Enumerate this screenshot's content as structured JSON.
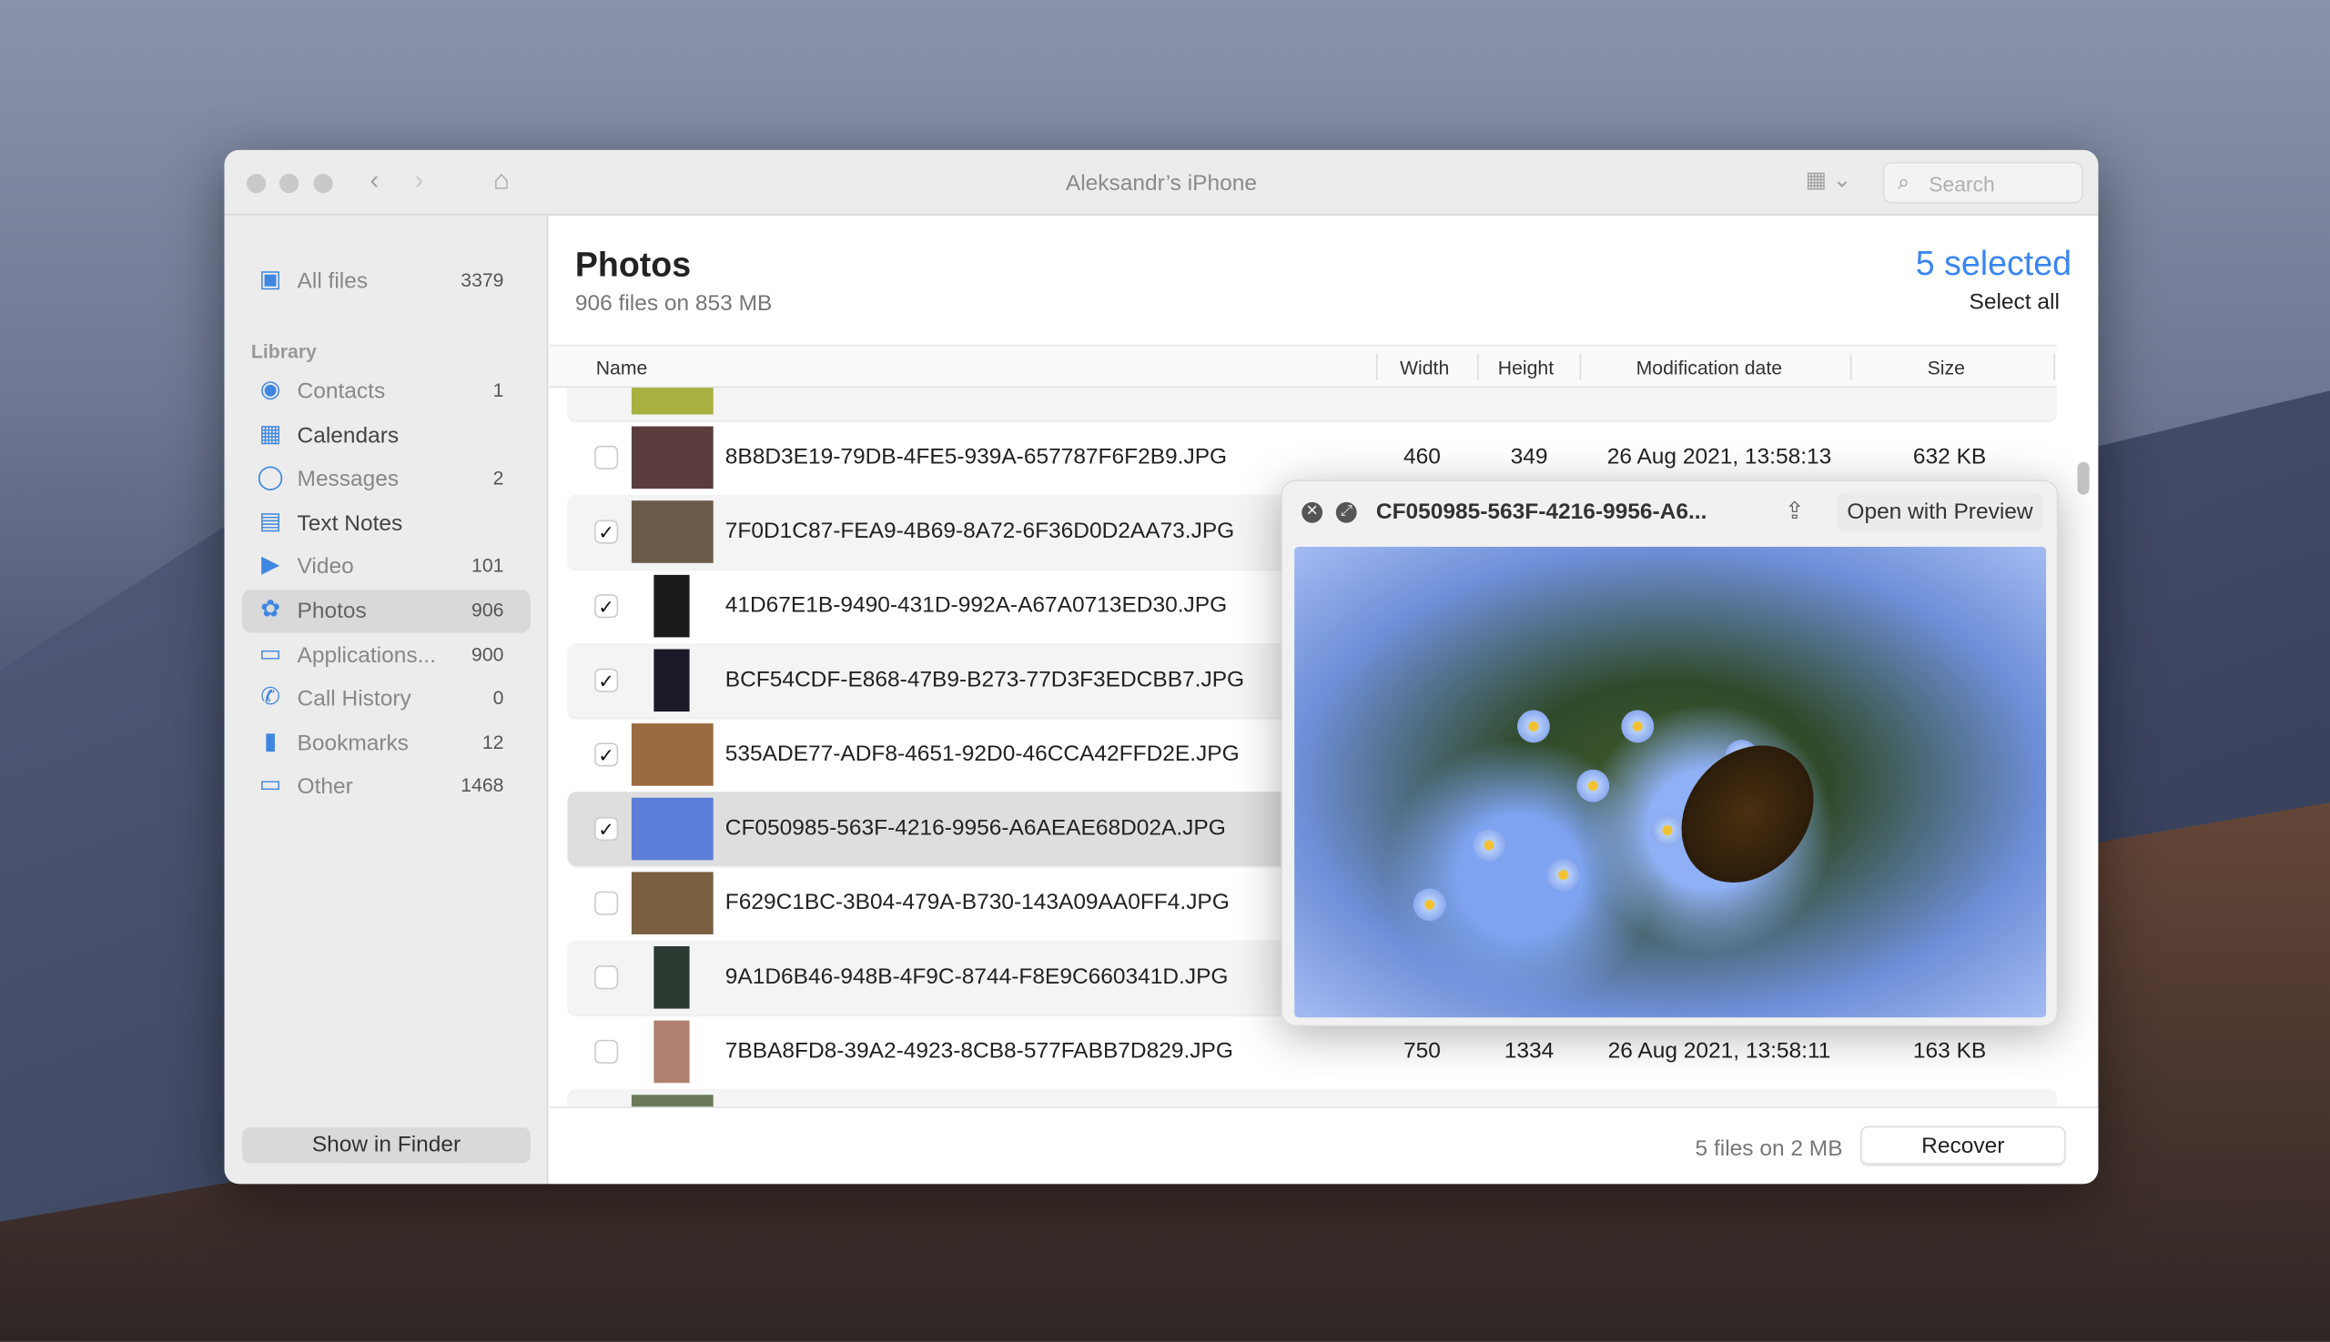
{
  "window": {
    "title": "Aleksandr’s iPhone",
    "search_placeholder": "Search"
  },
  "sidebar": {
    "all_files": {
      "label": "All files",
      "count": "3379"
    },
    "section": "Library",
    "items": [
      {
        "label": "Contacts",
        "count": "1",
        "icon": "person-circle-icon"
      },
      {
        "label": "Calendars",
        "count": "",
        "icon": "calendar-icon"
      },
      {
        "label": "Messages",
        "count": "2",
        "icon": "message-bubble-icon"
      },
      {
        "label": "Text Notes",
        "count": "",
        "icon": "notes-icon"
      },
      {
        "label": "Video",
        "count": "101",
        "icon": "video-camera-icon"
      },
      {
        "label": "Photos",
        "count": "906",
        "icon": "photos-flower-icon"
      },
      {
        "label": "Applications...",
        "count": "900",
        "icon": "applications-icon"
      },
      {
        "label": "Call History",
        "count": "0",
        "icon": "phone-icon"
      },
      {
        "label": "Bookmarks",
        "count": "12",
        "icon": "bookmark-icon"
      },
      {
        "label": "Other",
        "count": "1468",
        "icon": "folder-icon"
      }
    ],
    "show_in_finder": "Show in Finder"
  },
  "main": {
    "title": "Photos",
    "subtitle": "906 files on 853 MB",
    "selected": "5 selected",
    "select_all": "Select all",
    "columns": [
      "Name",
      "Width",
      "Height",
      "Modification date",
      "Size"
    ],
    "rows": [
      {
        "name": "8B8D3E19-79DB-4FE5-939A-657787F6F2B9.JPG",
        "width": "460",
        "height": "349",
        "date": "26 Aug 2021, 13:58:13",
        "size": "632 KB",
        "checked": false
      },
      {
        "name": "7F0D1C87-FEA9-4B69-8A72-6F36D0D2AA73.JPG",
        "width": "",
        "height": "",
        "date": "",
        "size": "",
        "checked": true
      },
      {
        "name": "41D67E1B-9490-431D-992A-A67A0713ED30.JPG",
        "width": "",
        "height": "",
        "date": "",
        "size": "",
        "checked": true
      },
      {
        "name": "BCF54CDF-E868-47B9-B273-77D3F3EDCBB7.JPG",
        "width": "",
        "height": "",
        "date": "",
        "size": "",
        "checked": true
      },
      {
        "name": "535ADE77-ADF8-4651-92D0-46CCA42FFD2E.JPG",
        "width": "",
        "height": "",
        "date": "",
        "size": "",
        "checked": true
      },
      {
        "name": "CF050985-563F-4216-9956-A6AEAE68D02A.JPG",
        "width": "",
        "height": "",
        "date": "",
        "size": "",
        "checked": true
      },
      {
        "name": "F629C1BC-3B04-479A-B730-143A09AA0FF4.JPG",
        "width": "",
        "height": "",
        "date": "",
        "size": "",
        "checked": false
      },
      {
        "name": "9A1D6B46-948B-4F9C-8744-F8E9C660341D.JPG",
        "width": "",
        "height": "",
        "date": "",
        "size": "",
        "checked": false
      },
      {
        "name": "7BBA8FD8-39A2-4923-8CB8-577FABB7D829.JPG",
        "width": "750",
        "height": "1334",
        "date": "26 Aug 2021, 13:58:11",
        "size": "163 KB",
        "checked": false
      }
    ],
    "footer": {
      "summary": "5 files on 2 MB",
      "recover": "Recover"
    }
  },
  "preview": {
    "title": "CF050985-563F-4216-9956-A6...",
    "open_with": "Open with Preview"
  },
  "colors": {
    "accent": "#3a86f0"
  }
}
